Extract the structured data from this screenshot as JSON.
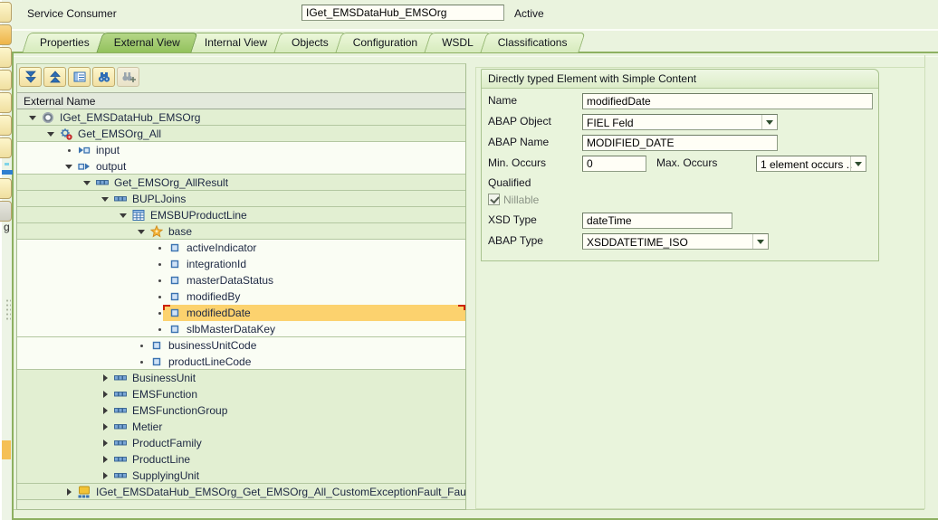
{
  "header": {
    "service_consumer_label": "Service Consumer",
    "service_name": "IGet_EMSDataHub_EMSOrg",
    "status": "Active"
  },
  "tabs": [
    {
      "label": "Properties",
      "active": false
    },
    {
      "label": "External View",
      "active": true
    },
    {
      "label": "Internal View",
      "active": false
    },
    {
      "label": "Objects",
      "active": false
    },
    {
      "label": "Configuration",
      "active": false
    },
    {
      "label": "WSDL",
      "active": false
    },
    {
      "label": "Classifications",
      "active": false
    }
  ],
  "toolbar": [
    {
      "name": "expand-all",
      "disabled": false
    },
    {
      "name": "collapse-all",
      "disabled": false
    },
    {
      "name": "detail-view",
      "disabled": false
    },
    {
      "name": "find",
      "disabled": false
    },
    {
      "name": "find-next",
      "disabled": true
    }
  ],
  "tree": {
    "header": "External Name",
    "nodes": [
      {
        "label": "IGet_EMSDataHub_EMSOrg",
        "level": 0,
        "arrow": "expanded",
        "icon": "interface",
        "bg": "g",
        "sep": true,
        "selected": false
      },
      {
        "label": "Get_EMSOrg_All",
        "level": 1,
        "arrow": "expanded",
        "icon": "operation",
        "bg": "g",
        "sep": true,
        "selected": false
      },
      {
        "label": "input",
        "level": 2,
        "arrow": "dot",
        "icon": "message-in",
        "bg": "w",
        "sep": false,
        "selected": false
      },
      {
        "label": "output",
        "level": 2,
        "arrow": "expanded",
        "icon": "message-out",
        "bg": "w",
        "sep": true,
        "selected": false
      },
      {
        "label": "Get_EMSOrg_AllResult",
        "level": 3,
        "arrow": "expanded",
        "icon": "complex-element",
        "bg": "g",
        "sep": true,
        "selected": false
      },
      {
        "label": "BUPLJoins",
        "level": 4,
        "arrow": "expanded",
        "icon": "complex-element",
        "bg": "g",
        "sep": true,
        "selected": false
      },
      {
        "label": "EMSBUProductLine",
        "level": 5,
        "arrow": "expanded",
        "icon": "table-type",
        "bg": "g",
        "sep": true,
        "selected": false
      },
      {
        "label": "base",
        "level": 6,
        "arrow": "expanded",
        "icon": "star",
        "bg": "g",
        "sep": true,
        "selected": false
      },
      {
        "label": "activeIndicator",
        "level": 7,
        "arrow": "dot",
        "icon": "simple-element",
        "bg": "w",
        "sep": false,
        "selected": false
      },
      {
        "label": "integrationId",
        "level": 7,
        "arrow": "dot",
        "icon": "simple-element",
        "bg": "w",
        "sep": false,
        "selected": false
      },
      {
        "label": "masterDataStatus",
        "level": 7,
        "arrow": "dot",
        "icon": "simple-element",
        "bg": "w",
        "sep": false,
        "selected": false
      },
      {
        "label": "modifiedBy",
        "level": 7,
        "arrow": "dot",
        "icon": "simple-element",
        "bg": "w",
        "sep": false,
        "selected": false
      },
      {
        "label": "modifiedDate",
        "level": 7,
        "arrow": "dot",
        "icon": "simple-element",
        "bg": "w",
        "sep": false,
        "selected": true
      },
      {
        "label": "slbMasterDataKey",
        "level": 7,
        "arrow": "dot",
        "icon": "simple-element",
        "bg": "w",
        "sep": true,
        "selected": false
      },
      {
        "label": "businessUnitCode",
        "level": 6,
        "arrow": "dot",
        "icon": "simple-element",
        "bg": "w",
        "sep": false,
        "selected": false
      },
      {
        "label": "productLineCode",
        "level": 6,
        "arrow": "dot",
        "icon": "simple-element",
        "bg": "w",
        "sep": true,
        "selected": false
      },
      {
        "label": "BusinessUnit",
        "level": 4,
        "arrow": "collapsed",
        "icon": "complex-element",
        "bg": "g",
        "sep": false,
        "selected": false
      },
      {
        "label": "EMSFunction",
        "level": 4,
        "arrow": "collapsed",
        "icon": "complex-element",
        "bg": "g",
        "sep": false,
        "selected": false
      },
      {
        "label": "EMSFunctionGroup",
        "level": 4,
        "arrow": "collapsed",
        "icon": "complex-element",
        "bg": "g",
        "sep": false,
        "selected": false
      },
      {
        "label": "Metier",
        "level": 4,
        "arrow": "collapsed",
        "icon": "complex-element",
        "bg": "g",
        "sep": false,
        "selected": false
      },
      {
        "label": "ProductFamily",
        "level": 4,
        "arrow": "collapsed",
        "icon": "complex-element",
        "bg": "g",
        "sep": false,
        "selected": false
      },
      {
        "label": "ProductLine",
        "level": 4,
        "arrow": "collapsed",
        "icon": "complex-element",
        "bg": "g",
        "sep": false,
        "selected": false
      },
      {
        "label": "SupplyingUnit",
        "level": 4,
        "arrow": "collapsed",
        "icon": "complex-element",
        "bg": "g",
        "sep": true,
        "selected": false
      },
      {
        "label": "IGet_EMSDataHub_EMSOrg_Get_EMSOrg_All_CustomExceptionFault_FaultM",
        "level": 2,
        "arrow": "collapsed",
        "icon": "fault-structure",
        "bg": "g",
        "sep": true,
        "selected": false
      }
    ]
  },
  "detail": {
    "title": "Directly typed Element with Simple Content",
    "name_label": "Name",
    "name_value": "modifiedDate",
    "abap_object_label": "ABAP Object",
    "abap_object_value": "FIEL Feld",
    "abap_name_label": "ABAP Name",
    "abap_name_value": "MODIFIED_DATE",
    "min_occurs_label": "Min. Occurs",
    "min_occurs_value": "0",
    "max_occurs_label": "Max. Occurs",
    "max_occurs_value": "1 element occurs ..",
    "qualified_label": "Qualified",
    "nillable_label": "Nillable",
    "nillable_checked": true,
    "xsd_type_label": "XSD Type",
    "xsd_type_value": "dateTime",
    "abap_type_label": "ABAP Type",
    "abap_type_value": "XSDDATETIME_ISO"
  },
  "left_strip": {
    "clipped_text": "g"
  },
  "colors": {
    "selection_orange": "#fcd26e",
    "active_tab_green": "#9cc768",
    "frame_green": "#8db061",
    "icon_blue": "#3a72b0",
    "selection_bracket_red": "#cc2200"
  }
}
